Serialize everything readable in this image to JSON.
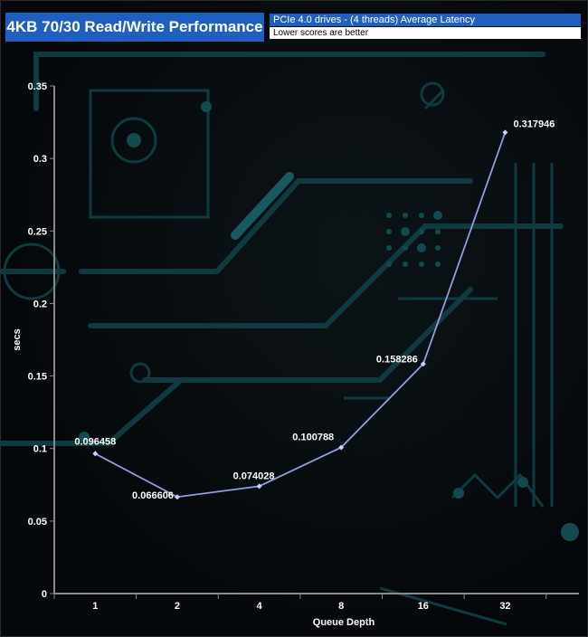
{
  "header": {
    "title": "4KB 70/30 Read/Write Performance",
    "subtitle": "PCIe 4.0 drives - (4 threads) Average Latency",
    "note": "Lower scores are better"
  },
  "chart_data": {
    "type": "line",
    "title": "4KB 70/30 Read/Write Performance",
    "subtitle": "PCIe 4.0 drives - (4 threads) Average Latency",
    "xlabel": "Queue Depth",
    "ylabel": "secs",
    "categories": [
      "1",
      "2",
      "4",
      "8",
      "16",
      "32"
    ],
    "series": [
      {
        "values": [
          0.096458,
          0.066606,
          0.074028,
          0.100788,
          0.158286,
          0.317946
        ]
      }
    ],
    "data_labels": [
      "0.096458",
      "0.066606",
      "0.074028",
      "0.100788",
      "0.158286",
      "0.317946"
    ],
    "ylim": [
      0,
      0.35
    ],
    "yticks": [
      0,
      0.05,
      0.1,
      0.15,
      0.2,
      0.25,
      0.3,
      0.35
    ],
    "ytick_labels": [
      "0",
      "0.05",
      "0.1",
      "0.15",
      "0.2",
      "0.25",
      "0.3",
      "0.35"
    ],
    "grid": false,
    "colors": {
      "line": "#8f9fe0",
      "marker": "#c8d0ff",
      "text": "#ffffff",
      "header": "#1f5fbf"
    }
  }
}
